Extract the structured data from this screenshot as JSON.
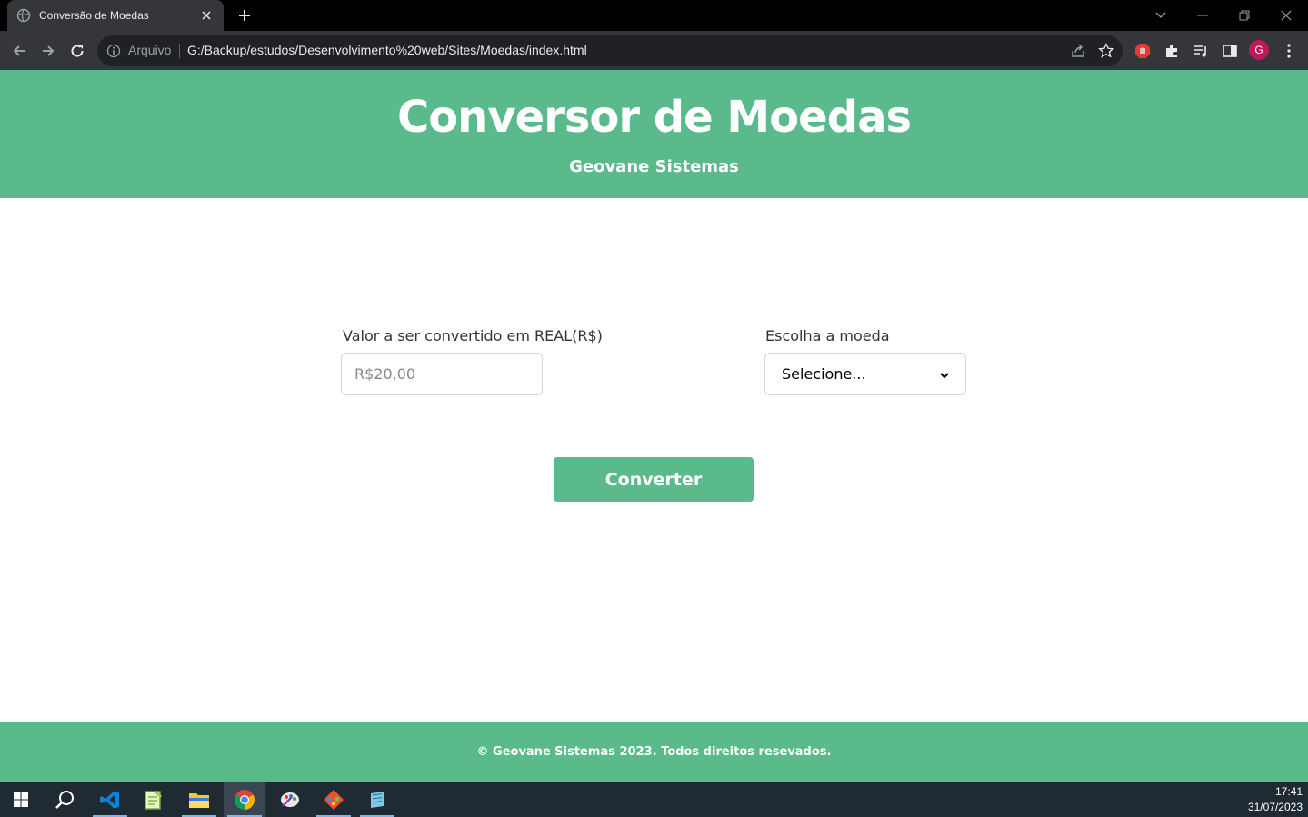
{
  "browser": {
    "tab_title": "Conversão de Moedas",
    "security_label": "Arquivo",
    "url": "G:/Backup/estudos/Desenvolvimento%20web/Sites/Moedas/index.html",
    "profile_initial": "G"
  },
  "header": {
    "title": "Conversor de Moedas",
    "subtitle": "Geovane Sistemas"
  },
  "form": {
    "amount_label": "Valor a ser convertido em REAL(R$)",
    "amount_placeholder": "R$20,00",
    "currency_label": "Escolha a moeda",
    "currency_selected": "Selecione...",
    "convert_label": "Converter"
  },
  "footer": {
    "text": "© Geovane Sistemas 2023. Todos direitos resevados."
  },
  "taskbar": {
    "time": "17:41",
    "date": "31/07/2023",
    "apps": [
      "start-icon",
      "search-icon",
      "vscode-icon",
      "notepad-plus-icon",
      "file-explorer-icon",
      "chrome-icon",
      "paint-app-icon",
      "git-icon",
      "notes-app-icon"
    ]
  },
  "colors": {
    "brand_green": "#5bba8b",
    "chrome_dark": "#35363a",
    "taskbar": "#1f2a33"
  }
}
